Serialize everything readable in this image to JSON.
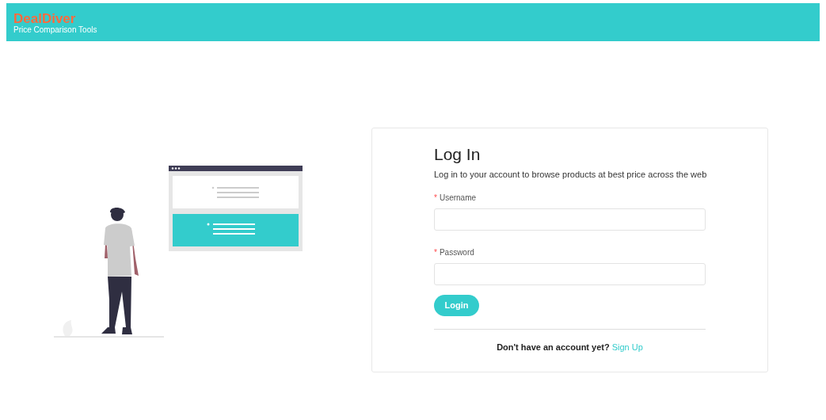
{
  "header": {
    "brand": "DealDiver",
    "tagline": "Price Comparison Tools"
  },
  "login": {
    "title": "Log In",
    "subtitle": "Log in to your account to browse products at best price across the web",
    "fields": [
      {
        "required_mark": "*",
        "label": "Username"
      },
      {
        "required_mark": "*",
        "label": "Password"
      }
    ],
    "submit": "Login",
    "signup_prompt": "Don't have an account yet?",
    "signup_link": "Sign Up"
  }
}
